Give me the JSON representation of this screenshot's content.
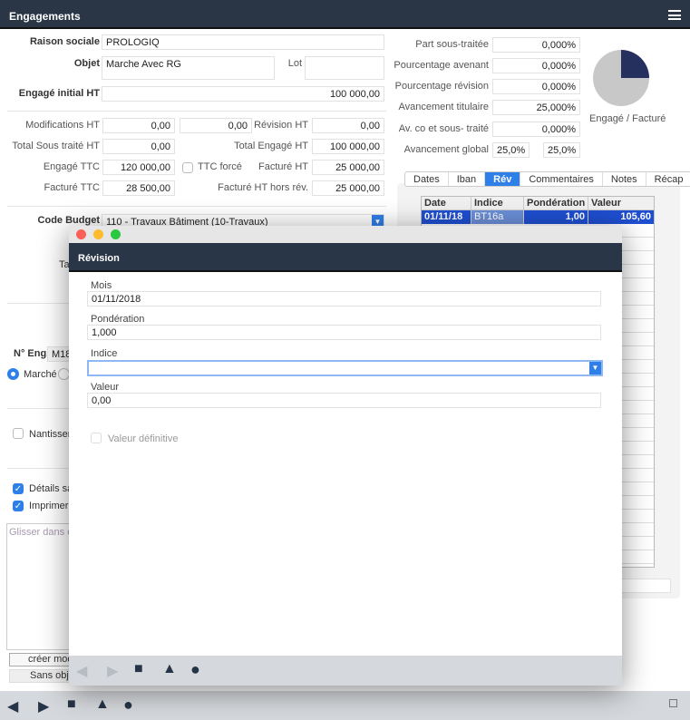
{
  "header": {
    "title": "Engagements",
    "menu_icon": "hamburger-icon"
  },
  "form": {
    "raison_sociale_label": "Raison sociale",
    "raison_sociale": "PROLOGIQ",
    "objet_label": "Objet",
    "objet": "Marche Avec RG",
    "lot_label": "Lot",
    "lot": "",
    "engage_initial_label": "Engagé initial HT",
    "engage_initial": "100 000,00",
    "modifications_label": "Modifications HT",
    "modifications_1": "0,00",
    "modifications_2": "0,00",
    "revision_label": "Révision HT",
    "revision": "0,00",
    "total_sous_traite_label": "Total Sous traité HT",
    "total_sous_traite": "0,00",
    "total_engage_label": "Total Engagé HT",
    "total_engage": "100 000,00",
    "engage_ttc_label": "Engagé TTC",
    "engage_ttc": "120 000,00",
    "ttc_force_label": "TTC forcé",
    "facture_ht_label": "Facturé HT",
    "facture_ht": "25 000,00",
    "facture_ttc_label": "Facturé TTC",
    "facture_ttc": "28 500,00",
    "facture_hors_rev_label": "Facturé HT hors rév.",
    "facture_hors_rev": "25 000,00",
    "code_budget_label": "Code Budget",
    "code_budget": "110 - Travaux Bâtiment (10-Travaux)",
    "ta_label": "Ta",
    "n_eng_label": "N° Eng.",
    "n_eng": "M18.",
    "marche_label": "Marché",
    "nantissement_label": "Nantissem",
    "details_label": "Détails sa",
    "imprimer_label": "Imprimer",
    "glisser_placeholder": "Glisser dans ce",
    "creer_button": "créer mod",
    "sans_objet_button": "Sans obje"
  },
  "stats": {
    "part_label": "Part sous-traitée",
    "part": "0,000%",
    "avenant_label": "Pourcentage avenant",
    "avenant": "0,000%",
    "revision_label": "Pourcentage révision",
    "revision": "0,000%",
    "titulaire_label": "Avancement titulaire",
    "titulaire": "25,000%",
    "co_label": "Av. co et sous- traité",
    "co": "0,000%",
    "global_label": "Avancement global",
    "global_1": "25,0%",
    "global_2": "25,0%",
    "pie_label": "Engagé / Facturé",
    "pie_facture_fraction": 0.25,
    "pie_colors": {
      "facture": "#25305f",
      "reste": "#c8c8c8"
    }
  },
  "tabs": [
    "Dates",
    "Iban",
    "Rév",
    "Commentaires",
    "Notes",
    "Récap"
  ],
  "active_tab": "Rév",
  "table": {
    "headers": [
      "Date",
      "Indice",
      "Pondération",
      "Valeur"
    ],
    "rows": [
      [
        "01/11/18",
        "BT16a",
        "1,00",
        "105,60"
      ]
    ]
  },
  "modal": {
    "title": "Révision",
    "mois_label": "Mois",
    "mois": "01/11/2018",
    "ponderation_label": "Pondération",
    "ponderation": "1,000",
    "indice_label": "Indice",
    "indice": "",
    "valeur_label": "Valeur",
    "valeur": "0,00",
    "definitive_label": "Valeur définitive"
  },
  "toolbar_icons": [
    "prev-icon",
    "next-icon",
    "square-icon",
    "triangle-icon",
    "circle-icon"
  ],
  "accent": "#2f7fe8"
}
